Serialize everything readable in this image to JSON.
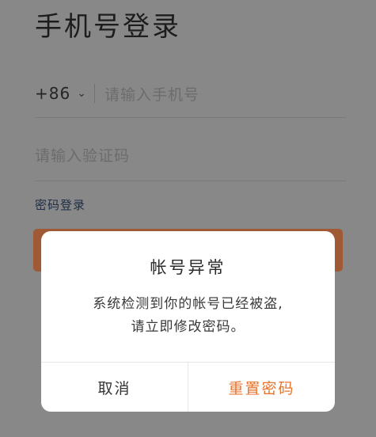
{
  "screen": {
    "title": "手机号登录"
  },
  "phone_field": {
    "country_code": "+86",
    "placeholder": "请输入手机号"
  },
  "code_field": {
    "placeholder": "请输入验证码"
  },
  "password_login_link": "密码登录",
  "dialog": {
    "title": "帐号异常",
    "message_line1": "系统检测到你的帐号已经被盗,",
    "message_line2": "请立即修改密码。",
    "cancel_label": "取消",
    "reset_label": "重置密码"
  },
  "colors": {
    "accent": "#e8742c",
    "login_button": "#a35b36"
  }
}
